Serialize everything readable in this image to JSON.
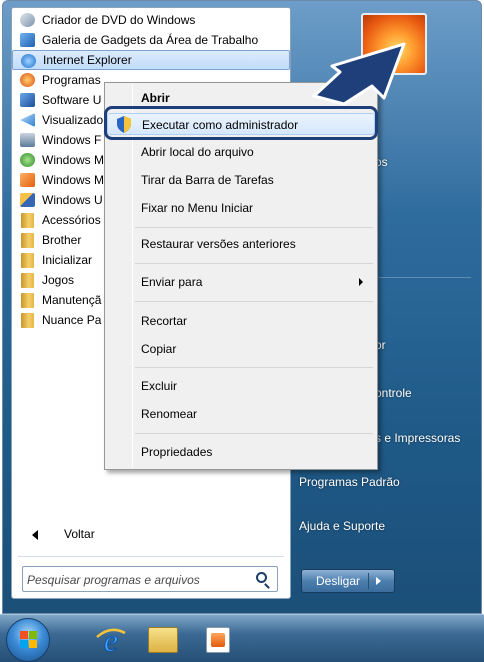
{
  "programs": [
    {
      "label": "Criador de DVD do Windows",
      "icon": "dvd-maker-icon",
      "color": "#8a9bb0"
    },
    {
      "label": "Galeria de Gadgets da Área de Trabalho",
      "icon": "gadgets-icon",
      "color": "#3b78c6"
    },
    {
      "label": "Internet Explorer",
      "icon": "internet-explorer-icon",
      "color": "#2a7ad6"
    },
    {
      "label": "Programas",
      "icon": "programs-icon",
      "color": "#e05a1c"
    },
    {
      "label": "Software U",
      "icon": "software-icon",
      "color": "#1f66b3"
    },
    {
      "label": "Visualizado",
      "icon": "viewer-icon",
      "color": "#2f7fd0"
    },
    {
      "label": "Windows F",
      "icon": "fax-icon",
      "color": "#5d7a9a"
    },
    {
      "label": "Windows M",
      "icon": "media-center-icon",
      "color": "#3c9a3a"
    },
    {
      "label": "Windows M",
      "icon": "media-player-icon",
      "color": "#ef7a20"
    },
    {
      "label": "Windows U",
      "icon": "update-icon",
      "color": "#3567b5"
    },
    {
      "label": "Acessórios",
      "icon": "folder-icon",
      "color": "#e6b545"
    },
    {
      "label": "Brother",
      "icon": "folder-icon",
      "color": "#e6b545"
    },
    {
      "label": "Inicializar",
      "icon": "folder-icon",
      "color": "#e6b545"
    },
    {
      "label": "Jogos",
      "icon": "folder-icon",
      "color": "#e6b545"
    },
    {
      "label": "Manutençã",
      "icon": "folder-icon",
      "color": "#e6b545"
    },
    {
      "label": "Nuance Pa",
      "icon": "folder-icon",
      "color": "#e6b545"
    }
  ],
  "back_label": "Voltar",
  "search_placeholder": "Pesquisar programas e arquivos",
  "right_items": [
    {
      "label": "os"
    },
    {
      "label": "or"
    },
    {
      "label": "ontrole"
    },
    {
      "label": "s e Impressoras"
    },
    {
      "label": "Programas Padrão"
    },
    {
      "label": "Ajuda e Suporte"
    }
  ],
  "shutdown_label": "Desligar",
  "context_menu": {
    "open": "Abrir",
    "run_as_admin": "Executar como administrador",
    "open_location": "Abrir local do arquivo",
    "unpin_taskbar": "Tirar da Barra de Tarefas",
    "pin_start": "Fixar no Menu Iniciar",
    "restore_versions": "Restaurar versões anteriores",
    "send_to": "Enviar para",
    "cut": "Recortar",
    "copy": "Copiar",
    "delete": "Excluir",
    "rename": "Renomear",
    "properties": "Propriedades"
  },
  "colors": {
    "accent_ring": "#1f3f7a",
    "highlight": "#d5e7fb"
  }
}
